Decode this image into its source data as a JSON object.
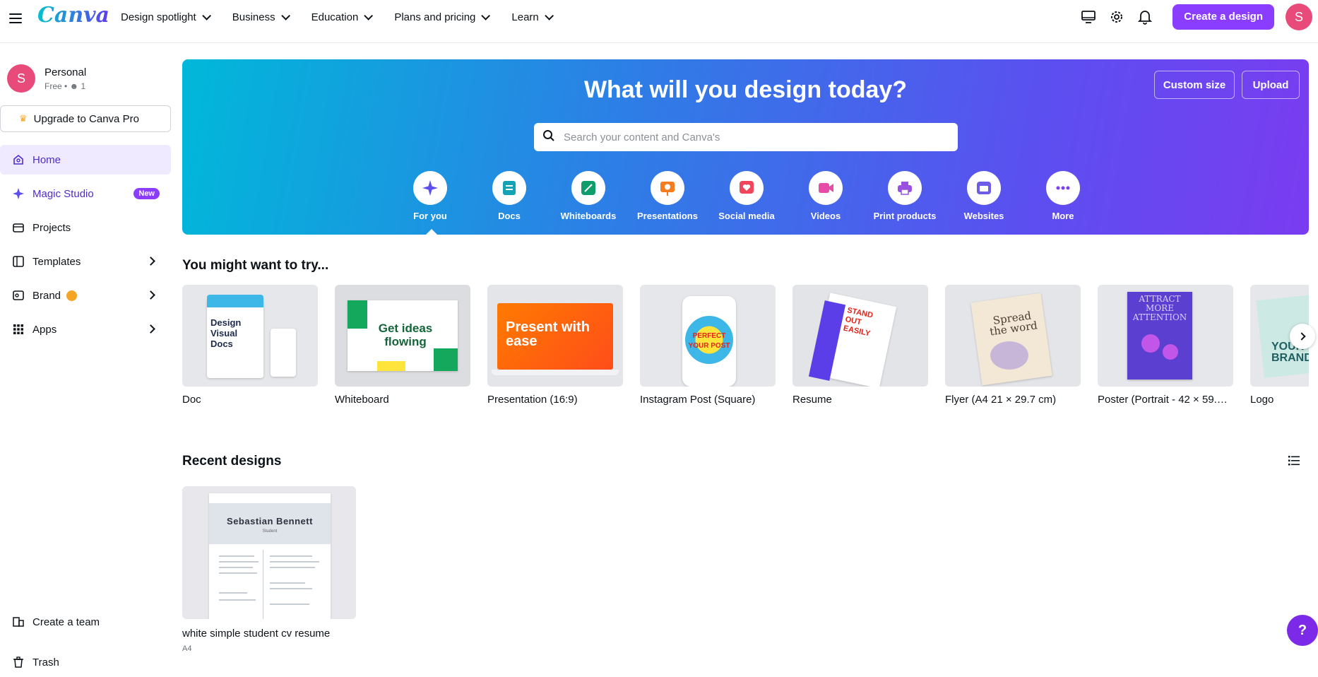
{
  "app": {
    "logo": "Canva"
  },
  "nav": [
    {
      "label": "Design spotlight"
    },
    {
      "label": "Business"
    },
    {
      "label": "Education"
    },
    {
      "label": "Plans and pricing"
    },
    {
      "label": "Learn"
    }
  ],
  "topbar": {
    "create_label": "Create a design",
    "avatar_initial": "S"
  },
  "account": {
    "initial": "S",
    "name": "Personal",
    "plan": "Free • ",
    "members": "1"
  },
  "upgrade": {
    "label": "Upgrade to Canva Pro"
  },
  "sidebar": {
    "items": [
      {
        "label": "Home"
      },
      {
        "label": "Magic Studio",
        "badge": "New"
      },
      {
        "label": "Projects"
      },
      {
        "label": "Templates"
      },
      {
        "label": "Brand"
      },
      {
        "label": "Apps"
      }
    ],
    "bottom": [
      {
        "label": "Create a team"
      },
      {
        "label": "Trash"
      }
    ]
  },
  "hero": {
    "title": "What will you design today?",
    "search_placeholder": "Search your content and Canva's",
    "custom_size": "Custom size",
    "upload": "Upload",
    "categories": [
      {
        "label": "For you",
        "icon": "sparkle-icon",
        "color": "#5b4ff0"
      },
      {
        "label": "Docs",
        "icon": "doc-icon",
        "color": "#13a3b5"
      },
      {
        "label": "Whiteboards",
        "icon": "whiteboard-icon",
        "color": "#0f9d6b"
      },
      {
        "label": "Presentations",
        "icon": "presentation-icon",
        "color": "#f57c1f"
      },
      {
        "label": "Social media",
        "icon": "heart-icon",
        "color": "#f0455b"
      },
      {
        "label": "Videos",
        "icon": "video-icon",
        "color": "#e64ca8"
      },
      {
        "label": "Print products",
        "icon": "printer-icon",
        "color": "#9b51e0"
      },
      {
        "label": "Websites",
        "icon": "website-icon",
        "color": "#6c5ce7"
      },
      {
        "label": "More",
        "icon": "more-icon",
        "color": "#7b3ff2"
      }
    ]
  },
  "suggestions": {
    "title": "You might want to try...",
    "items": [
      {
        "label": "Doc",
        "thumb_text": "Design Visual Docs"
      },
      {
        "label": "Whiteboard",
        "thumb_text": "Get ideas flowing"
      },
      {
        "label": "Presentation (16:9)",
        "thumb_text": "Present with ease"
      },
      {
        "label": "Instagram Post (Square)",
        "thumb_text": "PERFECT YOUR POST"
      },
      {
        "label": "Resume",
        "thumb_text": "STAND OUT EASILY"
      },
      {
        "label": "Flyer (A4 21 × 29.7 cm)",
        "thumb_text": "Spread the word"
      },
      {
        "label": "Poster (Portrait - 42 × 59.4 ...",
        "thumb_text": "ATTRACT MORE ATTENTION"
      },
      {
        "label": "Logo",
        "thumb_text": "YOUR BRAND"
      }
    ]
  },
  "recent": {
    "title": "Recent designs",
    "items": [
      {
        "name": "white simple student cv resume",
        "type": "A4",
        "cv_name": "Sebastian Bennett",
        "cv_sub": "Student"
      }
    ]
  },
  "help": {
    "label": "?"
  }
}
